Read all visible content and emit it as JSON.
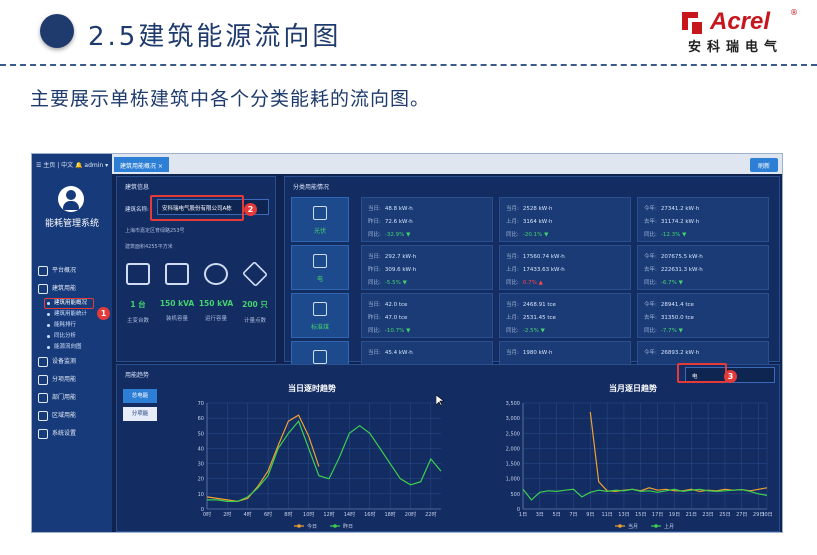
{
  "slide": {
    "heading": "2.5建筑能源流向图",
    "subtitle": "主要展示单栋建筑中各个分类能耗的流向图。",
    "logo_word": "Acrel",
    "logo_reg": "®",
    "logo_cn": "安科瑞电气"
  },
  "app": {
    "topbar_left": "☰ 主页 | 中文 🔔 admin ▾",
    "active_tab": "建筑用能概况 ×",
    "refresh": "刷新",
    "system_name": "能耗管理系统",
    "menu": [
      {
        "label": "平台概况"
      },
      {
        "label": "建筑用能"
      },
      {
        "label": "设备监测"
      },
      {
        "label": "分项用能"
      },
      {
        "label": "部门用能"
      },
      {
        "label": "区域用能"
      },
      {
        "label": "系统设置"
      }
    ],
    "submenu": [
      {
        "label": "建筑用能概况"
      },
      {
        "label": "建筑用能统计"
      },
      {
        "label": "能耗排行"
      },
      {
        "label": "同比分析"
      },
      {
        "label": "能源流向图"
      }
    ]
  },
  "building": {
    "title": "建筑信息",
    "name_label": "建筑名称:",
    "name_value": "安科瑞电气股份有限公司A栋",
    "address": "上海市嘉定区育绿路253号",
    "area": "建筑面积4255平方米",
    "stats": [
      {
        "value": "1 台",
        "label": "主变台数"
      },
      {
        "value": "150 kVA",
        "label": "装机容量"
      },
      {
        "value": "150 kVA",
        "label": "运行容量"
      },
      {
        "value": "200 只",
        "label": "计量点数"
      }
    ]
  },
  "classification": {
    "title": "分类用能情况",
    "rows": [
      {
        "type": "光伏",
        "cols": [
          {
            "k1": "当日:",
            "v1": "48.8 kW·h",
            "k2": "昨日:",
            "v2": "72.6 kW·h",
            "k3": "同比:",
            "v3": "-32.9%",
            "dir": "down"
          },
          {
            "k1": "当月:",
            "v1": "2528 kW·h",
            "k2": "上月:",
            "v2": "3164 kW·h",
            "k3": "同比:",
            "v3": "-20.1%",
            "dir": "down"
          },
          {
            "k1": "今年:",
            "v1": "27341.2 kW·h",
            "k2": "去年:",
            "v2": "31174.2 kW·h",
            "k3": "同比:",
            "v3": "-12.3%",
            "dir": "down"
          }
        ]
      },
      {
        "type": "电",
        "cols": [
          {
            "k1": "当日:",
            "v1": "292.7 kW·h",
            "k2": "昨日:",
            "v2": "309.6 kW·h",
            "k3": "同比:",
            "v3": "-5.5%",
            "dir": "down"
          },
          {
            "k1": "当月:",
            "v1": "17560.74 kW·h",
            "k2": "上月:",
            "v2": "17433.63 kW·h",
            "k3": "同比:",
            "v3": "0.7%",
            "dir": "up"
          },
          {
            "k1": "今年:",
            "v1": "207675.5 kW·h",
            "k2": "去年:",
            "v2": "222631.3 kW·h",
            "k3": "同比:",
            "v3": "-6.7%",
            "dir": "down"
          }
        ]
      },
      {
        "type": "标准煤",
        "cols": [
          {
            "k1": "当日:",
            "v1": "42.0 tce",
            "k2": "昨日:",
            "v2": "47.0 tce",
            "k3": "同比:",
            "v3": "-10.7%",
            "dir": "down"
          },
          {
            "k1": "当月:",
            "v1": "2468.91 tce",
            "k2": "上月:",
            "v2": "2531.45 tce",
            "k3": "同比:",
            "v3": "-2.5%",
            "dir": "down"
          },
          {
            "k1": "今年:",
            "v1": "28941.4 tce",
            "k2": "去年:",
            "v2": "31350.0 tce",
            "k3": "同比:",
            "v3": "-7.7%",
            "dir": "down"
          }
        ]
      },
      {
        "type": "",
        "cols": [
          {
            "k1": "当日:",
            "v1": "45.4 kW·h",
            "k2": "",
            "v2": "",
            "k3": "",
            "v3": "",
            "dir": ""
          },
          {
            "k1": "当月:",
            "v1": "1980 kW·h",
            "k2": "",
            "v2": "",
            "k3": "",
            "v3": "",
            "dir": ""
          },
          {
            "k1": "今年:",
            "v1": "26893.2 kW·h",
            "k2": "",
            "v2": "",
            "k3": "",
            "v3": "",
            "dir": ""
          }
        ]
      }
    ]
  },
  "trend": {
    "title": "用能趋势",
    "energy_select": "电",
    "btn_total": "总电能",
    "btn_sub": "分项能",
    "callouts": [
      "1",
      "2",
      "3"
    ]
  },
  "colors": {
    "today": "#f0a030",
    "yesterday": "#3ecf4e",
    "accent": "#2d7fd6",
    "highlight": "#e43a3a"
  },
  "chart_data": [
    {
      "type": "line",
      "title": "当日逐时趋势",
      "x": [
        "0时",
        "1时",
        "2时",
        "3时",
        "4时",
        "5时",
        "6时",
        "7时",
        "8时",
        "9时",
        "10时",
        "11时",
        "12时",
        "13时",
        "14时",
        "15时",
        "16时",
        "17时",
        "18时",
        "19时",
        "20时",
        "21时",
        "22时",
        "23时"
      ],
      "xticks": [
        "0时",
        "2时",
        "4时",
        "6时",
        "8时",
        "10时",
        "12时",
        "14时",
        "16时",
        "18时",
        "20时",
        "22时"
      ],
      "ylim": [
        0,
        70
      ],
      "yticks": [
        0,
        10,
        20,
        30,
        40,
        50,
        60,
        70
      ],
      "series": [
        {
          "name": "今日",
          "color": "#f0a030",
          "values": [
            8,
            7,
            6,
            5,
            7,
            15,
            25,
            42,
            58,
            62,
            48,
            28
          ]
        },
        {
          "name": "昨日",
          "color": "#3ecf4e",
          "values": [
            6,
            6,
            5,
            5,
            8,
            14,
            22,
            40,
            50,
            58,
            40,
            22,
            20,
            34,
            50,
            55,
            50,
            40,
            30,
            20,
            16,
            18,
            33,
            25
          ]
        }
      ],
      "legend": "bottom"
    },
    {
      "type": "line",
      "title": "当月逐日趋势",
      "x": [
        "1日",
        "2日",
        "3日",
        "4日",
        "5日",
        "6日",
        "7日",
        "8日",
        "9日",
        "10日",
        "11日",
        "12日",
        "13日",
        "14日",
        "15日",
        "16日",
        "17日",
        "18日",
        "19日",
        "20日",
        "21日",
        "22日",
        "23日",
        "24日",
        "25日",
        "26日",
        "27日",
        "28日",
        "29日",
        "30日"
      ],
      "xticks": [
        "1日",
        "3日",
        "5日",
        "7日",
        "9日",
        "11日",
        "13日",
        "15日",
        "17日",
        "19日",
        "21日",
        "23日",
        "25日",
        "27日",
        "29日",
        "30日"
      ],
      "ylim": [
        0,
        3500
      ],
      "yticks": [
        0,
        500,
        1000,
        1500,
        2000,
        2500,
        3000,
        3500
      ],
      "series": [
        {
          "name": "当月",
          "color": "#f0a030",
          "values": [
            null,
            null,
            null,
            null,
            null,
            null,
            null,
            null,
            3200,
            900,
            600,
            580,
            620,
            650,
            600,
            700,
            620,
            650,
            600,
            600,
            650,
            580,
            620,
            600,
            650,
            620,
            640,
            600,
            650,
            700
          ]
        },
        {
          "name": "上月",
          "color": "#3ecf4e",
          "values": [
            650,
            300,
            550,
            600,
            580,
            620,
            650,
            400,
            550,
            620,
            580,
            620,
            600,
            650,
            580,
            600,
            550,
            600,
            650,
            580,
            620,
            650,
            600,
            580,
            600,
            620,
            640,
            580,
            500,
            450
          ]
        }
      ],
      "legend": "bottom"
    }
  ]
}
